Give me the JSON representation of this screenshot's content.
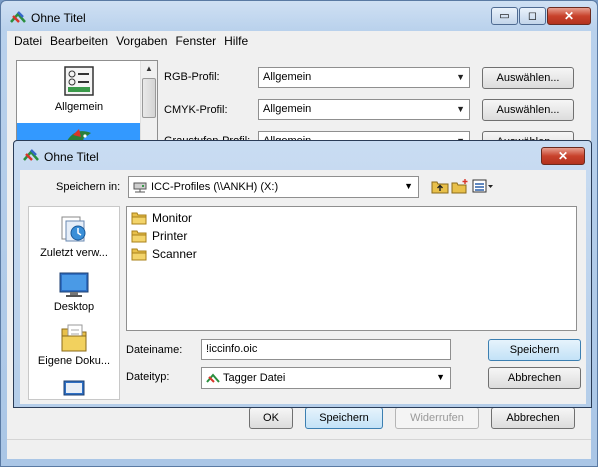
{
  "window": {
    "title": "Ohne Titel",
    "minimize_glyph": "▭",
    "maximize_glyph": "◻",
    "close_glyph": "✕"
  },
  "menu": [
    "Datei",
    "Bearbeiten",
    "Vorgaben",
    "Fenster",
    "Hilfe"
  ],
  "categories": [
    {
      "label": "Allgemein",
      "icon": "settings-panel-icon"
    },
    {
      "label": "",
      "icon": "bird-color-icon"
    }
  ],
  "profiles": [
    {
      "label": "RGB-Profil:",
      "value": "Allgemein",
      "button": "Auswählen..."
    },
    {
      "label": "CMYK-Profil:",
      "value": "Allgemein",
      "button": "Auswählen..."
    },
    {
      "label": "Graustufen-Profil:",
      "value": "Allgemein",
      "button": "Auswählen..."
    }
  ],
  "bottom_buttons": {
    "ok": "OK",
    "save": "Speichern",
    "revert": "Widerrufen",
    "cancel": "Abbrechen"
  },
  "dialog": {
    "title": "Ohne Titel",
    "close_glyph": "✕",
    "save_in_label": "Speichern in:",
    "save_in_value": "ICC-Profiles (\\\\ANKH) (X:)",
    "places": [
      {
        "label": "Zuletzt verw...",
        "icon": "recent-places-icon"
      },
      {
        "label": "Desktop",
        "icon": "desktop-icon"
      },
      {
        "label": "Eigene Doku...",
        "icon": "documents-folder-icon"
      },
      {
        "label": "",
        "icon": "computer-icon"
      }
    ],
    "files": [
      "Monitor",
      "Printer",
      "Scanner"
    ],
    "filename_label": "Dateiname:",
    "filename_value": "!iccinfo.oic",
    "filetype_label": "Dateityp:",
    "filetype_value": "Tagger Datei",
    "save_button": "Speichern",
    "cancel_button": "Abbrechen"
  },
  "colors": {
    "accent": "#3399ff",
    "title_bar": "#b9d1ec",
    "close_red": "#c8422c"
  }
}
